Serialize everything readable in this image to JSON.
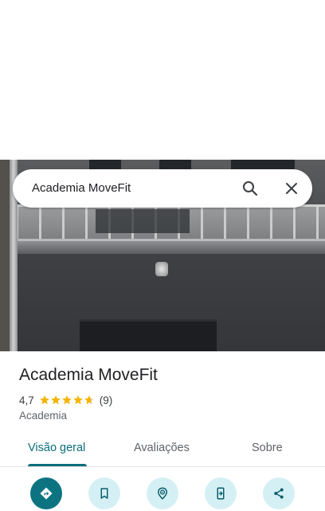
{
  "search": {
    "query": "Academia MoveFit"
  },
  "place": {
    "name": "Academia MoveFit",
    "rating": "4,7",
    "rating_stars": 4.7,
    "review_count": "(9)",
    "category": "Academia"
  },
  "tabs": [
    {
      "label": "Visão geral",
      "active": true
    },
    {
      "label": "Avaliações",
      "active": false
    },
    {
      "label": "Sobre",
      "active": false
    }
  ],
  "actions": [
    {
      "icon": "directions-icon"
    },
    {
      "icon": "bookmark-icon"
    },
    {
      "icon": "nearby-icon"
    },
    {
      "icon": "send-to-phone-icon"
    },
    {
      "icon": "share-icon"
    }
  ],
  "colors": {
    "accent": "#0b6e7a",
    "star": "#f4b400",
    "action_bg": "#d5f0f5"
  }
}
